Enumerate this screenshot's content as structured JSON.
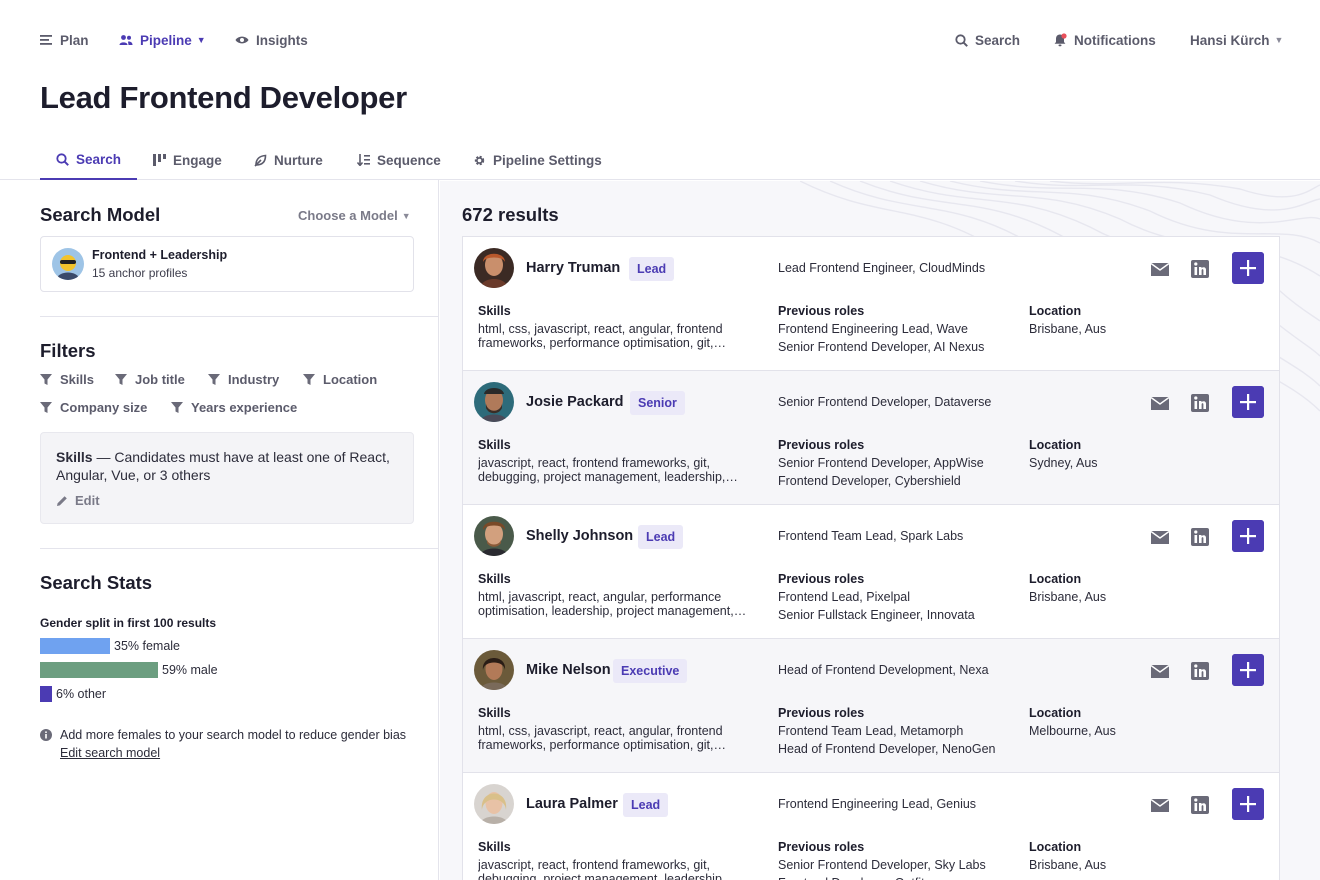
{
  "topnav": {
    "plan": "Plan",
    "pipeline": "Pipeline",
    "insights": "Insights",
    "search": "Search",
    "notifications": "Notifications",
    "user": "Hansi Kürch"
  },
  "page_title": "Lead Frontend Developer",
  "tabs": [
    {
      "label": "Search",
      "icon": "search-icon",
      "active": true
    },
    {
      "label": "Engage",
      "icon": "engage-icon"
    },
    {
      "label": "Nurture",
      "icon": "nurture-icon"
    },
    {
      "label": "Sequence",
      "icon": "sequence-icon"
    },
    {
      "label": "Pipeline Settings",
      "icon": "gear-icon"
    }
  ],
  "search_model": {
    "title": "Search Model",
    "choose": "Choose a Model",
    "name": "Frontend + Leadership",
    "subtitle": "15 anchor profiles"
  },
  "filters": {
    "title": "Filters",
    "items": [
      "Skills",
      "Job title",
      "Industry",
      "Location",
      "Company size",
      "Years experience"
    ],
    "skills_box": {
      "label": "Skills",
      "text": " — Candidates must have at least one of React, Angular, Vue, or 3 others",
      "edit": "Edit"
    }
  },
  "stats": {
    "title": "Search Stats",
    "gender_label": "Gender split in first 100 results",
    "female": {
      "percent": 35,
      "label": "35% female",
      "color": "#6fa2f0"
    },
    "male": {
      "percent": 59,
      "label": "59% male",
      "color": "#6c9e80"
    },
    "other": {
      "percent": 6,
      "label": "6% other",
      "color": "#4b3bb3"
    },
    "hint": "Add more females to your search model to reduce gender bias",
    "hint_link": "Edit search model"
  },
  "results": {
    "count": "672 results",
    "skills_label": "Skills",
    "prev_label": "Previous roles",
    "location_label": "Location",
    "candidates": [
      {
        "name": "Harry Truman",
        "level": "Lead",
        "current_role": "Lead Frontend Engineer, CloudMinds",
        "skills": "html, css, javascript, react, angular, frontend frameworks, performance optimisation, git, debugging, project management",
        "prev_roles": [
          "Frontend Engineering Lead, Wave",
          "Senior Frontend Developer, AI Nexus"
        ],
        "location": "Brisbane, Aus"
      },
      {
        "name": "Josie Packard",
        "level": "Senior",
        "current_role": "Senior Frontend Developer, Dataverse",
        "skills": "javascript, react, frontend frameworks, git, debugging, project management, leadership, team management",
        "prev_roles": [
          "Senior Frontend Developer, AppWise",
          "Frontend Developer, Cybershield"
        ],
        "location": "Sydney, Aus"
      },
      {
        "name": "Shelly Johnson",
        "level": "Lead",
        "current_role": "Frontend Team Lead, Spark Labs",
        "skills": "html, javascript, react, angular, performance optimisation, leadership, project management, git",
        "prev_roles": [
          "Frontend Lead, Pixelpal",
          "Senior Fullstack Engineer, Innovata"
        ],
        "location": "Brisbane, Aus"
      },
      {
        "name": "Mike Nelson",
        "level": "Executive",
        "current_role": "Head of Frontend Development, Nexa",
        "skills": "html, css, javascript, react, angular, frontend frameworks, performance optimisation, git, debugging",
        "prev_roles": [
          "Frontend Team Lead, Metamorph",
          "Head of Frontend Developer, NenoGen"
        ],
        "location": "Melbourne, Aus"
      },
      {
        "name": "Laura Palmer",
        "level": "Lead",
        "current_role": "Frontend Engineering Lead, Genius",
        "skills": "javascript, react, frontend frameworks, git, debugging, project management, leadership, team management",
        "prev_roles": [
          "Senior Frontend Developer, Sky Labs",
          "Frontend Developer, Outfit"
        ],
        "location": "Brisbane, Aus"
      }
    ]
  },
  "colors": {
    "accent": "#4b3bb3",
    "badge_bg": "#ebe9f8"
  }
}
